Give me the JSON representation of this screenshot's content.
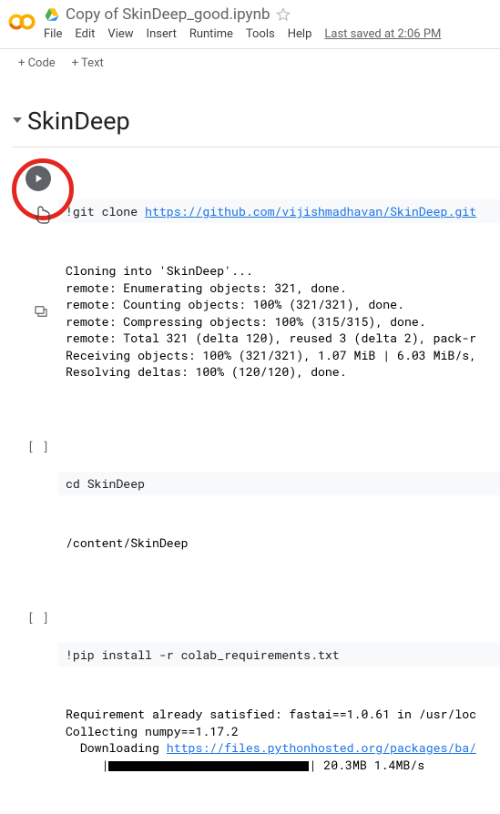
{
  "header": {
    "doc_title": "Copy of SkinDeep_good.ipynb",
    "last_saved": "Last saved at 2:06 PM"
  },
  "menu": {
    "file": "File",
    "edit": "Edit",
    "view": "View",
    "insert": "Insert",
    "runtime": "Runtime",
    "tools": "Tools",
    "help": "Help"
  },
  "toolbar": {
    "code": "+ Code",
    "text": "+ Text"
  },
  "section": {
    "title": "SkinDeep"
  },
  "cells": [
    {
      "code_prefix": "!git clone ",
      "code_link": "https://github.com/vijishmadhavan/SkinDeep.git",
      "output": "Cloning into 'SkinDeep'...\nremote: Enumerating objects: 321, done.\nremote: Counting objects: 100% (321/321), done.\nremote: Compressing objects: 100% (315/315), done.\nremote: Total 321 (delta 120), reused 3 (delta 2), pack-r\nReceiving objects: 100% (321/321), 1.07 MiB | 6.03 MiB/s,\nResolving deltas: 100% (120/120), done."
    },
    {
      "bracket": "[ ]",
      "code": "cd SkinDeep",
      "output": "/content/SkinDeep"
    },
    {
      "bracket": "[ ]",
      "code": "!pip install -r colab_requirements.txt",
      "out_line1": "Requirement already satisfied: fastai==1.0.61 in /usr/loc",
      "out_line2": "Collecting numpy==1.17.2",
      "out_line3_prefix": "  Downloading ",
      "out_line3_link": "https://files.pythonhosted.org/packages/ba/",
      "out_progress_prefix": "     |",
      "out_progress_suffix": "| 20.3MB 1.4MB/s"
    }
  ]
}
